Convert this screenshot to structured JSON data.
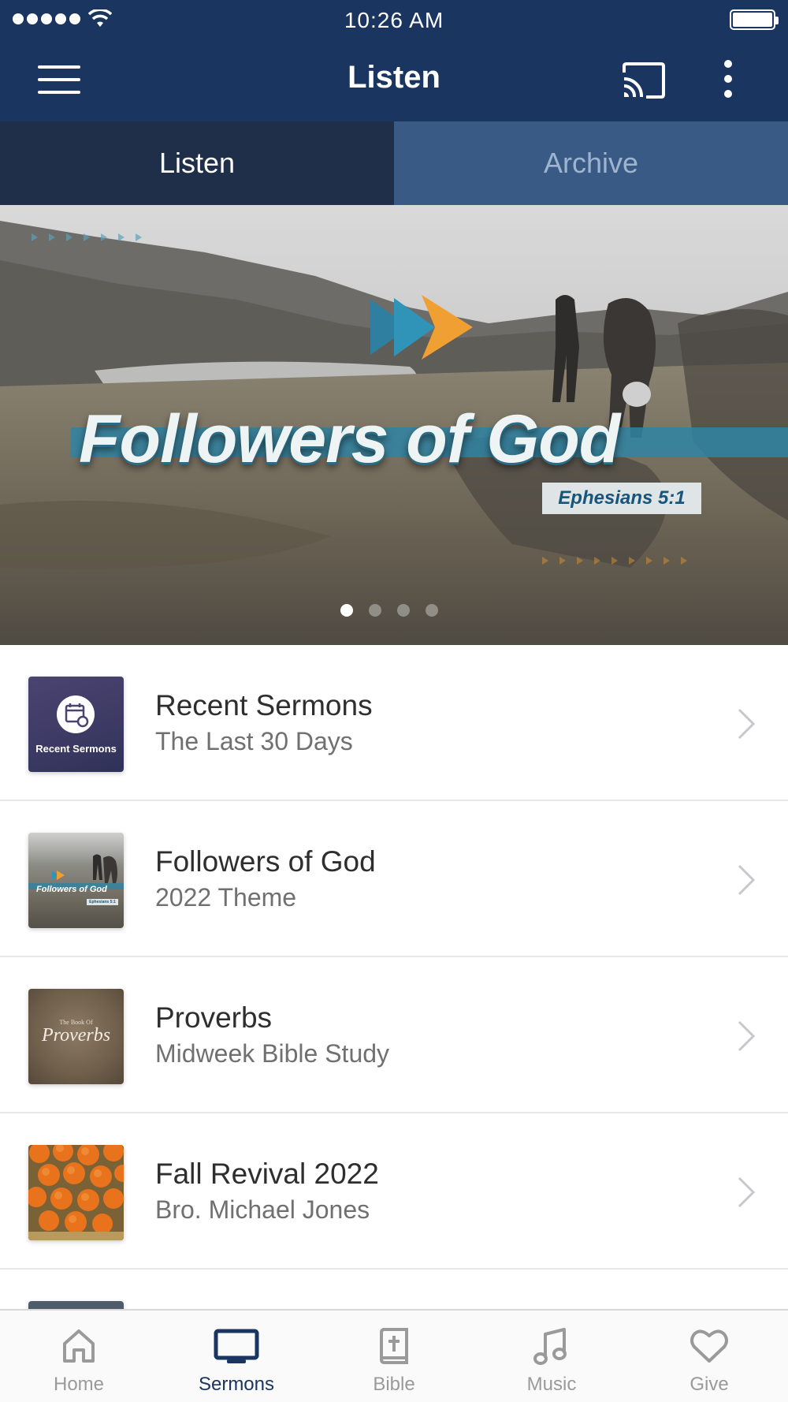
{
  "status_bar": {
    "time": "10:26 AM"
  },
  "header": {
    "title": "Listen"
  },
  "tabs": [
    {
      "label": "Listen",
      "active": true
    },
    {
      "label": "Archive",
      "active": false
    }
  ],
  "hero": {
    "title": "Followers of God",
    "reference": "Ephesians 5:1",
    "slide_count": 4,
    "active_slide": 1
  },
  "list": [
    {
      "title": "Recent Sermons",
      "subtitle": "The Last 30 Days",
      "thumb_label": "Recent Sermons",
      "thumb_icon": "calendar-refresh-icon"
    },
    {
      "title": "Followers of God",
      "subtitle": "2022 Theme",
      "thumb_label": "Followers of God",
      "thumb_ref": "Ephesians 5:1"
    },
    {
      "title": "Proverbs",
      "subtitle": "Midweek Bible Study",
      "thumb_small": "The Book Of",
      "thumb_label": "Proverbs"
    },
    {
      "title": "Fall Revival 2022",
      "subtitle": "Bro. Michael Jones"
    }
  ],
  "bottom_nav": [
    {
      "label": "Home",
      "icon": "home-icon",
      "active": false
    },
    {
      "label": "Sermons",
      "icon": "tv-icon",
      "active": true
    },
    {
      "label": "Bible",
      "icon": "bible-icon",
      "active": false
    },
    {
      "label": "Music",
      "icon": "music-note-icon",
      "active": false
    },
    {
      "label": "Give",
      "icon": "heart-icon",
      "active": false
    }
  ],
  "colors": {
    "header_bg": "#1a3560",
    "tab_active_bg": "#1f2f49",
    "tab_inactive_bg": "#3a5a86",
    "nav_active": "#1a3560",
    "nav_inactive": "#9a9a9a"
  }
}
